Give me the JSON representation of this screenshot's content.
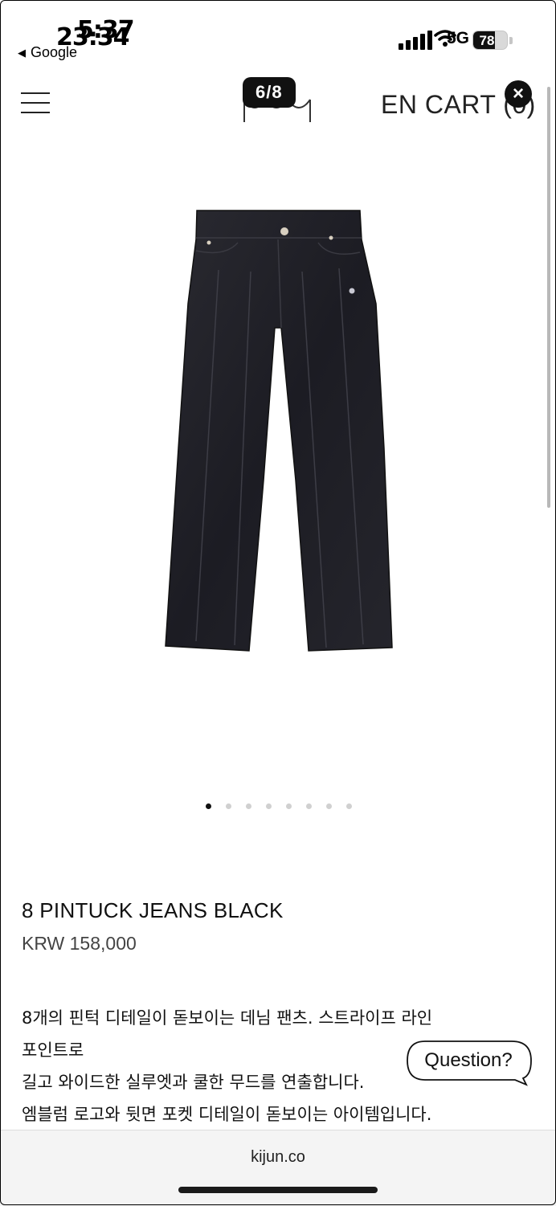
{
  "status_bar": {
    "time_overlay": "5:37",
    "time": "23:34",
    "back_app": "Google",
    "network": "5G",
    "battery": "78",
    "battery_level": 0.78
  },
  "header": {
    "counter": "6/8",
    "cart": "EN CART (0)"
  },
  "product_image": {
    "alt": "8 PINTUCK JEANS BLACK"
  },
  "carousel": {
    "count": 8,
    "active_index": 0
  },
  "product": {
    "name": "8 PINTUCK JEANS BLACK",
    "price": "KRW 158,000",
    "description": [
      "8개의 핀턱 디테일이 돋보이는 데님 팬츠. 스트라이프 라인",
      "포인트로",
      "길고 와이드한 실루엣과 쿨한 무드를 연출합니다.",
      "엠블럼 로고와 뒷면 포켓 디테일이 돋보이는 아이템입니다."
    ]
  },
  "question_button": "Question?",
  "browser": {
    "url": "kijun.co"
  }
}
